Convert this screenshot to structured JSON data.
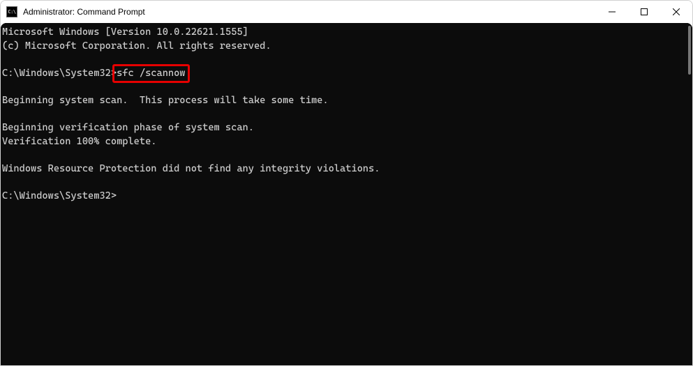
{
  "window": {
    "title": "Administrator: Command Prompt",
    "icon_text": "C:\\"
  },
  "terminal": {
    "lines": [
      "Microsoft Windows [Version 10.0.22621.1555]",
      "(c) Microsoft Corporation. All rights reserved.",
      "",
      "",
      "",
      "Beginning system scan.  This process will take some time.",
      "",
      "Beginning verification phase of system scan.",
      "Verification 100% complete.",
      "",
      "Windows Resource Protection did not find any integrity violations.",
      ""
    ],
    "first_prompt": {
      "path": "C:\\Windows\\System32>",
      "cmd": "sfc /scannow"
    },
    "last_prompt": {
      "path": "C:\\Windows\\System32>",
      "cmd": ""
    }
  },
  "highlight": {
    "target": "sfc /scannow"
  }
}
